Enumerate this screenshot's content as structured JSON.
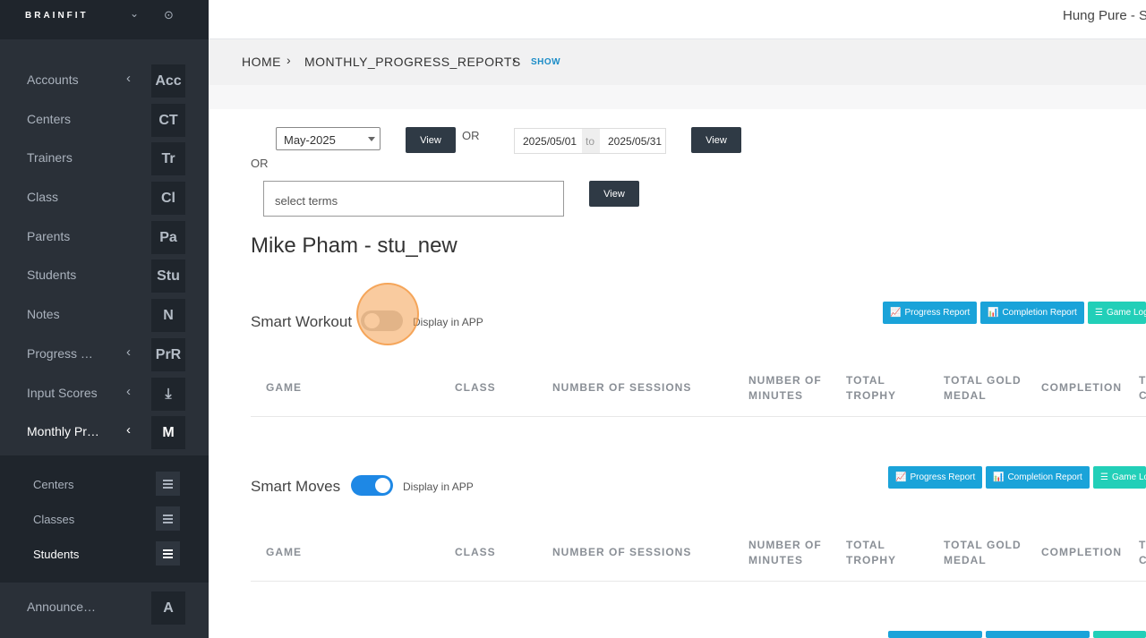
{
  "sidebar": {
    "logo": "BRAINFIT",
    "items": [
      {
        "label": "Accounts",
        "tile": "Acc",
        "arrow": true,
        "active": false
      },
      {
        "label": "Centers",
        "tile": "CT",
        "arrow": false,
        "active": false
      },
      {
        "label": "Trainers",
        "tile": "Tr",
        "arrow": false,
        "active": false
      },
      {
        "label": "Class",
        "tile": "Cl",
        "arrow": false,
        "active": false
      },
      {
        "label": "Parents",
        "tile": "Pa",
        "arrow": false,
        "active": false
      },
      {
        "label": "Students",
        "tile": "Stu",
        "arrow": false,
        "active": false
      },
      {
        "label": "Notes",
        "tile": "N",
        "arrow": false,
        "active": false
      },
      {
        "label": "Progress …",
        "tile": "PrR",
        "arrow": true,
        "active": false
      },
      {
        "label": "Input Scores",
        "tile": "⤓",
        "arrow": true,
        "active": false
      },
      {
        "label": "Monthly Pr…",
        "tile": "M",
        "arrow": true,
        "active": true
      }
    ],
    "submenu": [
      {
        "label": "Centers",
        "active": false
      },
      {
        "label": "Classes",
        "active": false
      },
      {
        "label": "Students",
        "active": true
      }
    ],
    "bottom_item": {
      "label": "Announce…",
      "tile": "A"
    }
  },
  "topbar": {
    "user_name": "Hung Pure - S"
  },
  "breadcrumb": {
    "home": "HOME",
    "section": "MONTHLY_PROGRESS_REPORTS",
    "current": "SHOW"
  },
  "filters": {
    "month_value": "May-2025",
    "view_label": "View",
    "or_label": "OR",
    "date_from": "2025/05/01",
    "date_to_label": "to",
    "date_end": "2025/05/31",
    "terms_placeholder": "select terms"
  },
  "student_title": "Mike Pham - stu_new",
  "sections": [
    {
      "title": "Smart Workout",
      "toggle_on": false,
      "display_label": "Display in APP",
      "buttons": {
        "progress": "Progress Report",
        "completion": "Completion Report",
        "game_log": "Game Log"
      },
      "columns": [
        "GAME",
        "CLASS",
        "NUMBER OF SESSIONS",
        "NUMBER OF MINUTES",
        "TOTAL TROPHY",
        "TOTAL GOLD MEDAL",
        "COMPLETION",
        "T C"
      ]
    },
    {
      "title": "Smart Moves",
      "toggle_on": true,
      "display_label": "Display in APP",
      "buttons": {
        "progress": "Progress Report",
        "completion": "Completion Report",
        "game_log": "Game Log"
      },
      "columns": [
        "GAME",
        "CLASS",
        "NUMBER OF SESSIONS",
        "NUMBER OF MINUTES",
        "TOTAL TROPHY",
        "TOTAL GOLD MEDAL",
        "COMPLETION",
        "T C"
      ]
    }
  ],
  "colors": {
    "sidebar": "#2a3038",
    "accent_blue": "#1aa3d9",
    "accent_teal": "#22cfb8",
    "toggle_on": "#1e88e5",
    "highlight": "#f4a050"
  }
}
